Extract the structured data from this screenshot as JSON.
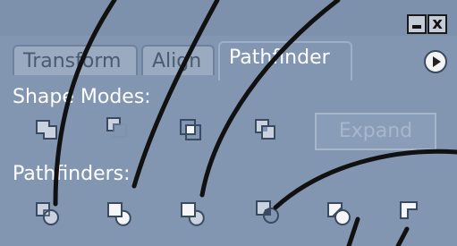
{
  "window": {
    "minimize_icon": "minimize-icon",
    "close_icon": "close-icon",
    "close_glyph": "x"
  },
  "tabs": [
    {
      "label": "Transform",
      "active": false
    },
    {
      "label": "Align",
      "active": false
    },
    {
      "label": "Pathfinder",
      "active": true
    }
  ],
  "panel_menu_icon": "panel-menu-arrow-icon",
  "shape_modes": {
    "label": "Shape Modes:",
    "buttons": [
      {
        "icon": "add-to-shape-area-icon"
      },
      {
        "icon": "subtract-from-shape-area-icon"
      },
      {
        "icon": "intersect-shape-areas-icon"
      },
      {
        "icon": "exclude-overlapping-shape-areas-icon"
      }
    ],
    "expand_label": "Expand",
    "expand_enabled": false
  },
  "pathfinders": {
    "label": "Pathfinders:",
    "buttons": [
      {
        "icon": "divide-icon"
      },
      {
        "icon": "trim-icon"
      },
      {
        "icon": "merge-icon"
      },
      {
        "icon": "crop-icon"
      },
      {
        "icon": "outline-icon"
      },
      {
        "icon": "minus-back-icon"
      }
    ]
  },
  "colors": {
    "panel_bg": "#8296b2",
    "active_tab_text": "#ffffff",
    "inactive_tab_text": "#4a5a70",
    "disabled_button_text": "#a7b6cb",
    "overlay_stroke": "#111111"
  }
}
